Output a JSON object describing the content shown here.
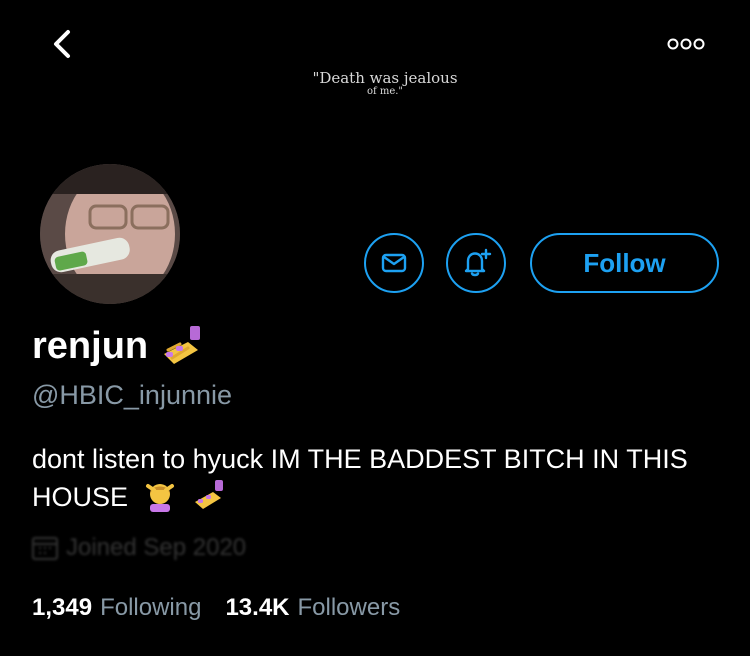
{
  "banner": {
    "quote_line1": "\"Death was jealous",
    "quote_line2": "of me.\""
  },
  "profile": {
    "display_name": "renjun",
    "handle": "@HBIC_injunnie",
    "bio": "dont listen to hyuck IM THE BADDEST BITCH IN THIS HOUSE",
    "joined": "Joined Sep 2020"
  },
  "actions": {
    "follow_label": "Follow"
  },
  "stats": {
    "following_count": "1,349",
    "following_label": "Following",
    "followers_count": "13.4K",
    "followers_label": "Followers"
  },
  "colors": {
    "accent": "#1da1f2",
    "secondary_text": "#8899a6",
    "background": "#000000"
  },
  "icons": [
    "back-chevron-icon",
    "more-options-icon",
    "mail-icon",
    "bell-plus-icon",
    "nail-polish-emoji-icon",
    "massage-emoji-icon",
    "calendar-icon"
  ]
}
